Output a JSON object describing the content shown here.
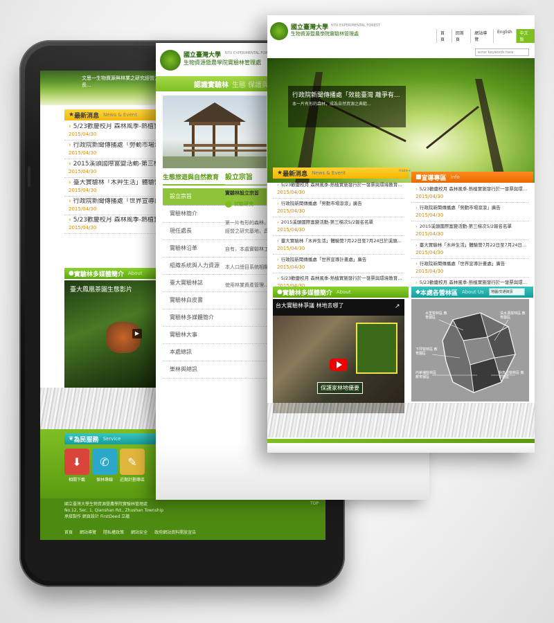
{
  "front": {
    "logo_title": "國立臺灣大學",
    "logo_title_en": "NTU EXPERIMENTAL FOREST",
    "logo_subtitle": "生物資源暨農學院實驗林管理處",
    "top_links": [
      "首頁",
      "回首頁",
      "網站導覽",
      "English",
      "中文版"
    ],
    "search_placeholder": "enter keywords here",
    "hero_caption": "行政院新聞傳播處「效能臺灣 離爭有...",
    "hero_text": "本一片有形的森林，成為自然資源之典範...",
    "news_title": "最新消息",
    "news_title_en": "News & Event",
    "news_more": "more+",
    "news": [
      {
        "title": "5/23歡慶校月 森林風季-熱植實施發行於一發票與環境教育推廣活...",
        "date": "2015/04/30"
      },
      {
        "title": "行政院新聞傳播處「勞動市場滾滾」廣告",
        "date": "2015/04/30"
      },
      {
        "title": "2015溪頭國際富變活動-第三梯次5/2報名名單",
        "date": "2015/04/30"
      },
      {
        "title": "臺大實驗林「木艸生活」體驗營7月22日至7月24日於溪頭木材利用...",
        "date": "2015/04/30"
      },
      {
        "title": "行政院新聞傳播處「世界宣導計畫處」廣告",
        "date": "2015/04/30"
      },
      {
        "title": "5/23歡慶校月 森林風季-熱植實施發行於一發票與環境教育推廣活...",
        "date": "2015/04/30"
      }
    ],
    "announce_title": "宣導專區",
    "announce_title_en": "Info",
    "announce": [
      {
        "title": "5/23歡慶校月 森林風季-熱植實施發行於一發票與環境教育推廣活動",
        "date": "2015/04/30"
      },
      {
        "title": "行政院新聞傳播處「勞動市場滾滾」廣告",
        "date": "2015/04/30"
      },
      {
        "title": "2015溪頭國際富變活動-第三梯次5/2報名名單",
        "date": "2015/04/30"
      },
      {
        "title": "臺大實驗林「木艸生活」體驗營7月22日至7月24日於溪頭木材利用...",
        "date": "2015/04/30"
      },
      {
        "title": "行政院新聞傳播處「世界宣導計畫處」廣告",
        "date": "2015/04/30"
      },
      {
        "title": "5/23歡慶校月 森林風季-熱植實施發行於一發票與環境教育推廣活動",
        "date": "2015/04/30"
      }
    ],
    "video_title": "實驗林多媒體簡介",
    "video_title_en": "About",
    "video_caption": "台大實驗林爭議 林地去哪了",
    "video_overlay": "保護家林地優要",
    "map_title": "本處各營林區",
    "map_title_en": "About Us",
    "map_dropdown": "地圖/交通資訊",
    "map_labels": [
      "水里營林區 教育園區",
      "清水溝營林區 教育園區",
      "下坪營林區 教育園區",
      "內茅埔營林區 教育園區",
      "對高岳營林區 教育園區"
    ]
  },
  "middle": {
    "logo_title": "國立臺灣大學",
    "logo_title_en": "NTU EXPERIMENTAL FOREST",
    "logo_subtitle": "生物資源暨農學院實驗林管理處",
    "banner_left": "認識實驗林",
    "banner_right": "生態 保護與教",
    "side_heading": "生態旅遊與自然教育",
    "menu": [
      "設立宗旨",
      "實驗林簡介",
      "現任處長",
      "實驗林沿革",
      "組織系統與人力資源",
      "臺大實驗林誌",
      "實驗林白皮書",
      "實驗林多媒體簡介",
      "實驗林大事",
      "本處總訊",
      "樂林與總訊"
    ],
    "content_title": "設立宗旨",
    "content_subtitle": "實驗林設立宗旨",
    "content_badge": "試驗研究",
    "paragraphs": [
      "第一片有形的森林，成為自然資源之典範，以及學術研究、經營、試驗、研究、教學、森林經營之研究基地，具有多種與保育任務之使命，提供永續發展之研究...",
      "自有，本處實驗林工作本務依林業發展，以自然環境保育，兼顧產業發展及推廣教育...",
      "本人口總目系统相關試驗研究，兼辦教學、林業推廣、研究地...",
      "使用林業資產管理..."
    ]
  },
  "tablet": {
    "news_title": "最新消息",
    "news_title_en": "News & Event",
    "news": [
      {
        "title": "5/23歡慶校月 森林風季-熱植實施發行於一發票",
        "date": "2015/04/30"
      },
      {
        "title": "行政院新聞傳播處「勞動市場滾滾」廣告",
        "date": "2015/04/30"
      },
      {
        "title": "2015溪頭國際富變活動-第三梯次5/2報名",
        "date": "2015/04/30"
      },
      {
        "title": "臺大實驗林「木艸生活」體驗營7月22日至",
        "date": "2015/04/30"
      },
      {
        "title": "行政院新聞傳播處「世界宣導計畫處」",
        "date": "2015/04/30"
      },
      {
        "title": "5/23歡慶校月 森林風季-熱植實施發行",
        "date": "2015/04/30"
      }
    ],
    "video_title": "實驗林多媒體簡介",
    "video_title_en": "About",
    "video_caption": "臺大鳳凰茶園生態影片",
    "service_title": "為民服務",
    "service_title_en": "Service",
    "services": [
      "相關下載",
      "保林專線",
      "近期計劃專區"
    ],
    "footer_lines": [
      "國立臺灣大學生物資源暨農學院實驗林管理處",
      "No.12, Sec. 1, Qianshan Rd., Zhushan Township",
      "承接製作 網頁設計 FirstDeed 立蘊"
    ],
    "footer_links": [
      "首頁",
      "網站導覽",
      "隱私權政策",
      "網站安全",
      "政府網站資料開放宣告"
    ],
    "top_label": "TOP",
    "hero_text": "文思一生物資源與林業之研究經營方向，千年長..."
  },
  "colors": {
    "accent_green": "#7fbf24",
    "news_yellow": "#f3b600",
    "announce_orange": "#e86a00",
    "map_teal": "#179c99"
  }
}
